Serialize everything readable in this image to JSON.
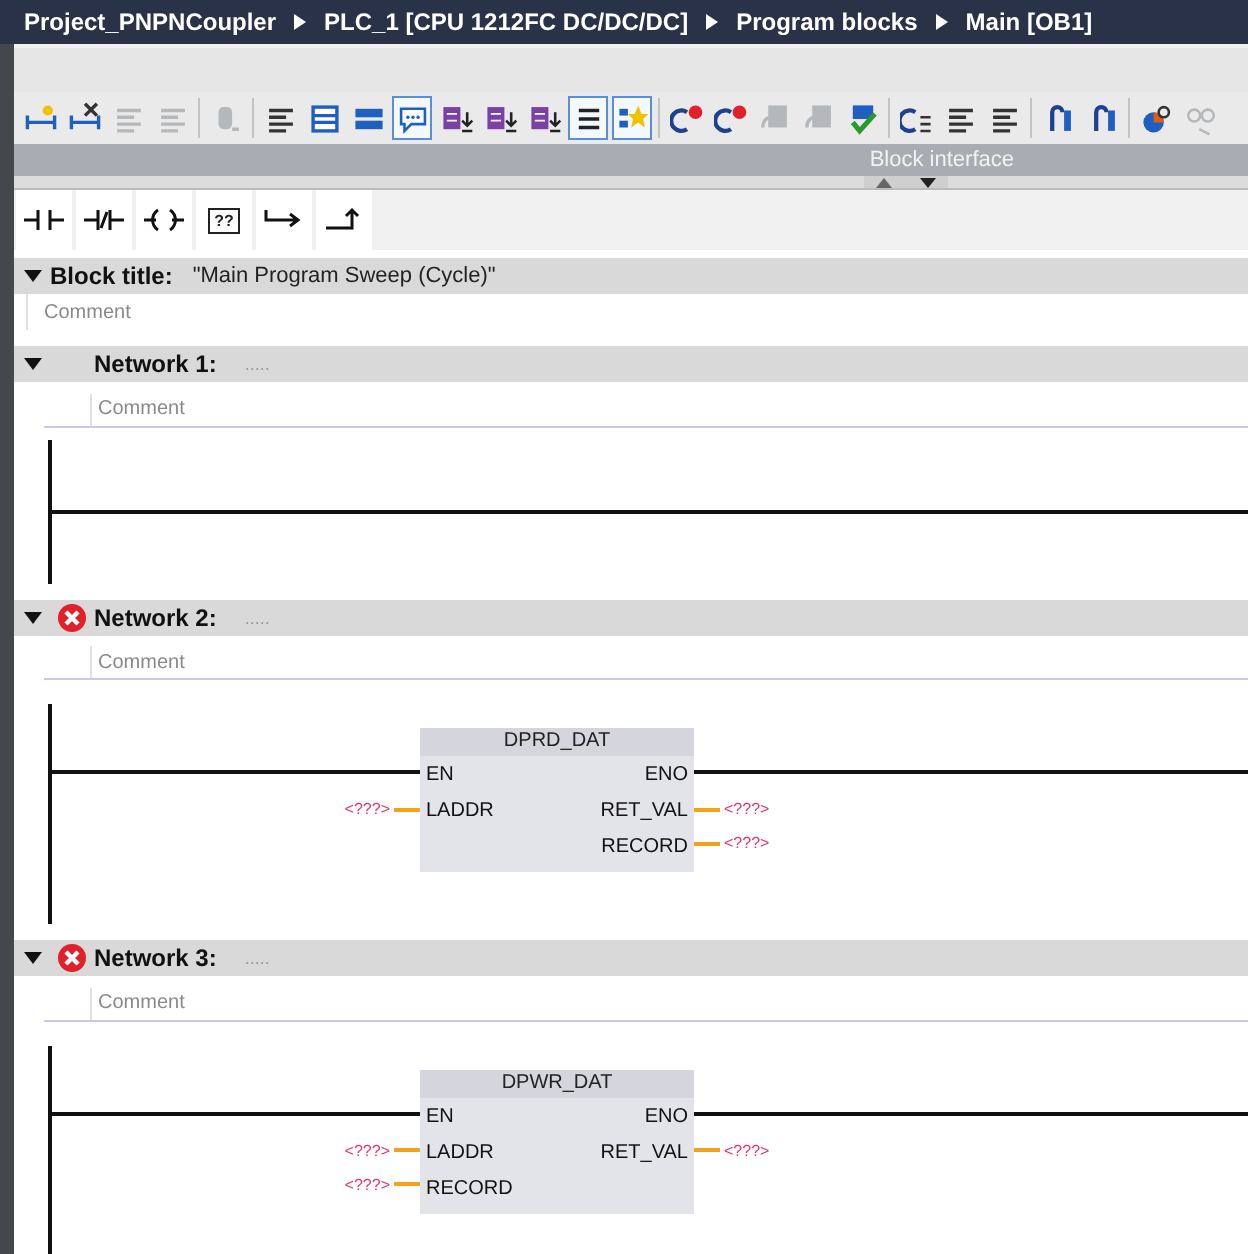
{
  "breadcrumb": [
    "Project_PNPNCoupler",
    "PLC_1 [CPU 1212FC DC/DC/DC]",
    "Program blocks",
    "Main [OB1]"
  ],
  "toolbar": [
    {
      "kind": "network-add",
      "on": false,
      "disabled": false
    },
    {
      "kind": "network-delete",
      "on": false,
      "disabled": false
    },
    {
      "kind": "lines",
      "on": false,
      "disabled": true
    },
    {
      "kind": "lines",
      "on": false,
      "disabled": true
    },
    {
      "kind": "sep"
    },
    {
      "kind": "database",
      "on": false,
      "disabled": true
    },
    {
      "kind": "sep"
    },
    {
      "kind": "lines",
      "on": false,
      "disabled": false
    },
    {
      "kind": "window",
      "on": false,
      "disabled": false
    },
    {
      "kind": "bars",
      "on": false,
      "disabled": false
    },
    {
      "kind": "bubble",
      "on": true,
      "disabled": false
    },
    {
      "kind": "download",
      "on": false,
      "disabled": false
    },
    {
      "kind": "download",
      "on": false,
      "disabled": false
    },
    {
      "kind": "download",
      "on": false,
      "disabled": false
    },
    {
      "kind": "list",
      "on": true,
      "disabled": false
    },
    {
      "kind": "star",
      "on": true,
      "disabled": false
    },
    {
      "kind": "sep"
    },
    {
      "kind": "error-arrow",
      "on": false,
      "disabled": false
    },
    {
      "kind": "error-arrow",
      "on": false,
      "disabled": false
    },
    {
      "kind": "document",
      "on": false,
      "disabled": true
    },
    {
      "kind": "document",
      "on": false,
      "disabled": true
    },
    {
      "kind": "check",
      "on": false,
      "disabled": false
    },
    {
      "kind": "sep"
    },
    {
      "kind": "arrow",
      "on": false,
      "disabled": false
    },
    {
      "kind": "lines",
      "on": false,
      "disabled": false
    },
    {
      "kind": "lines",
      "on": false,
      "disabled": false
    },
    {
      "kind": "sep"
    },
    {
      "kind": "jump",
      "on": false,
      "disabled": false
    },
    {
      "kind": "jump",
      "on": false,
      "disabled": false
    },
    {
      "kind": "sep"
    },
    {
      "kind": "chart",
      "on": false,
      "disabled": false
    },
    {
      "kind": "glasses",
      "on": false,
      "disabled": true
    }
  ],
  "interface_bar": {
    "title": "Block interface"
  },
  "lad_palette": [
    {
      "kind": "contact"
    },
    {
      "kind": "negated-contact"
    },
    {
      "kind": "coil"
    },
    {
      "kind": "box",
      "label": "??"
    },
    {
      "kind": "jump"
    },
    {
      "kind": "return"
    }
  ],
  "block_title": {
    "label": "Block title:",
    "value": "\"Main Program Sweep (Cycle)\"",
    "comment_placeholder": "Comment",
    "expanded": true
  },
  "networks": [
    {
      "title": "Network 1:",
      "dots": ".....",
      "error": false,
      "expanded": true,
      "comment_placeholder": "Comment"
    },
    {
      "title": "Network 2:",
      "dots": ".....",
      "error": true,
      "expanded": true,
      "comment_placeholder": "Comment",
      "block": {
        "name": "DPRD_DAT",
        "rows": [
          {
            "in": "EN",
            "out": "ENO"
          },
          {
            "in": "LADDR",
            "in_operand": "<???>",
            "out": "RET_VAL",
            "out_operand": "<???>"
          },
          {
            "out": "RECORD",
            "out_operand": "<???>"
          }
        ]
      }
    },
    {
      "title": "Network 3:",
      "dots": ".....",
      "error": true,
      "expanded": true,
      "comment_placeholder": "Comment",
      "block": {
        "name": "DPWR_DAT",
        "rows": [
          {
            "in": "EN",
            "out": "ENO"
          },
          {
            "in": "LADDR",
            "in_operand": "<???>",
            "out": "RET_VAL",
            "out_operand": "<???>"
          },
          {
            "in": "RECORD",
            "in_operand": "<???>"
          }
        ]
      }
    }
  ]
}
